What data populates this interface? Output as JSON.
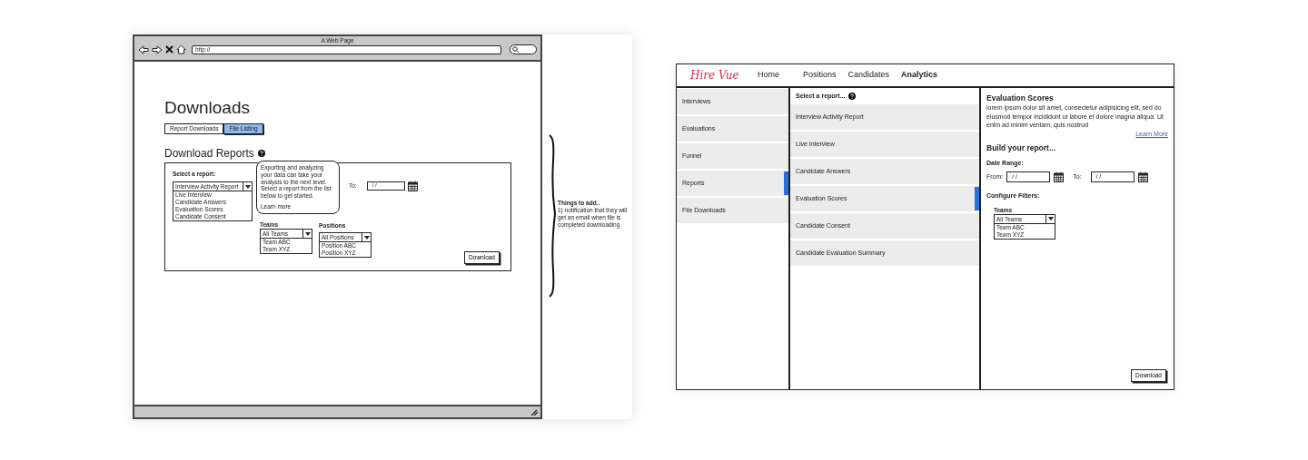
{
  "browser": {
    "title": "A Web Page",
    "url": "http://"
  },
  "page": {
    "heading": "Downloads",
    "tabs": [
      {
        "label": "Report Downloads",
        "selected": false
      },
      {
        "label": "File Listing",
        "selected": true
      }
    ],
    "section_title": "Download Reports",
    "tooltip": {
      "text": "Exporting and analyzing your data can take your analysis to the next level. Select a report from the list below to get started.",
      "link": "Learn more"
    },
    "report_select": {
      "label": "Select a report:",
      "value": "Interview Activity Report",
      "options": [
        "Live Interview",
        "Candidate Answers",
        "Evaluation Scores",
        "Candidate Consent"
      ]
    },
    "to_label": "To:",
    "to_date": "/ /",
    "teams": {
      "label": "Teams",
      "value": "All Teams",
      "options": [
        "Team ABC",
        "Team XYZ"
      ]
    },
    "positions": {
      "label": "Positions",
      "value": "All Positions",
      "options": [
        "Position ABC",
        "Position XYZ"
      ]
    },
    "download_button": "Download"
  },
  "note": {
    "title": "Things to add..",
    "text": "1) notification that they will get an email when file is completed downloading"
  },
  "app": {
    "logo": "Hire Vue",
    "nav": [
      {
        "label": "Home",
        "selected": false
      },
      {
        "label": "Positions",
        "selected": false
      },
      {
        "label": "Candidates",
        "selected": false
      },
      {
        "label": "Analytics",
        "selected": true
      }
    ],
    "sidebar": [
      {
        "label": "Interviews",
        "selected": false
      },
      {
        "label": "Evaluations",
        "selected": false
      },
      {
        "label": "Funnel",
        "selected": false
      },
      {
        "label": "Reports",
        "selected": true
      },
      {
        "label": "File Downloads",
        "selected": false
      }
    ],
    "report_list": {
      "title": "Select a report...",
      "items": [
        {
          "label": "Interview Activity Report",
          "selected": false
        },
        {
          "label": "Live Interview",
          "selected": false
        },
        {
          "label": "Candidate Answers",
          "selected": false
        },
        {
          "label": "Evaluation Scores",
          "selected": true
        },
        {
          "label": "Candidate Consent",
          "selected": false
        },
        {
          "label": "Candidate Evaluation Summary",
          "selected": false
        }
      ]
    },
    "detail": {
      "title": "Evaluation Scores",
      "description": "lorem ipsum dolor sit amet, consectetur adipisicing elit, sed do eiusmod tempor incididunt ut labore et dolore magna aliqua. Ut enim ad minim veniam, quis nostrud",
      "link": "Learn More",
      "build_title": "Build your report...",
      "date_range_label": "Date Range:",
      "from_label": "From:",
      "from_date": "/ /",
      "to_label": "To:",
      "to_date": "/ /",
      "filters_label": "Configure Filters:",
      "teams": {
        "label": "Teams",
        "value": "All Teams",
        "options": [
          "Team ABC",
          "Team XYZ"
        ]
      },
      "download_button": "Download"
    }
  }
}
